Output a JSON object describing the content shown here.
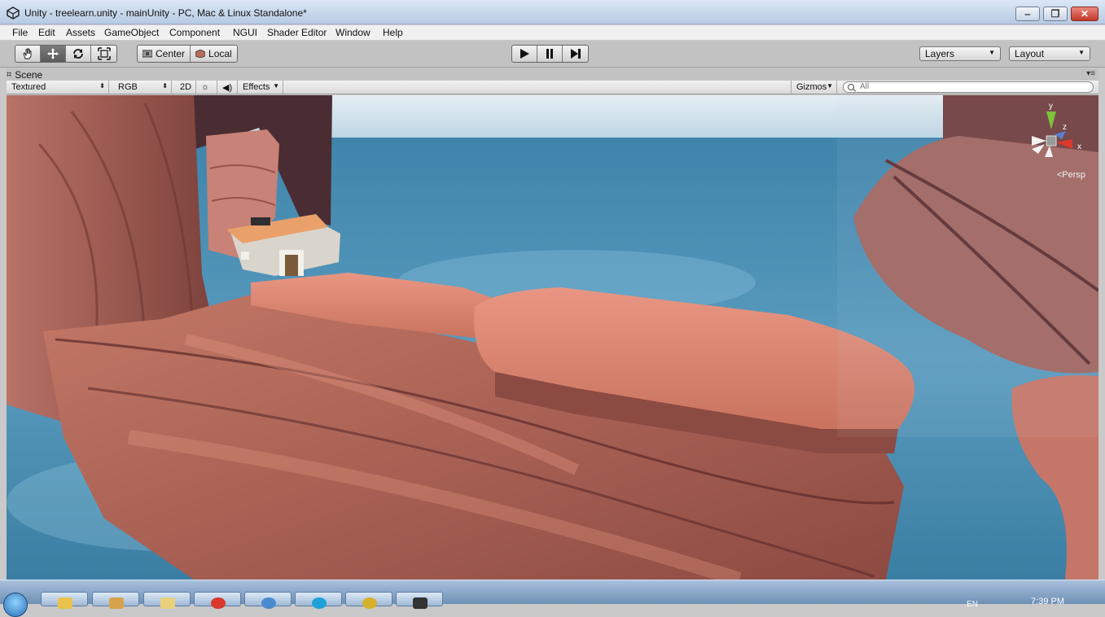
{
  "window": {
    "title": "Unity - treelearn.unity - mainUnity - PC, Mac & Linux Standalone*",
    "app_icon": "unity-logo-icon",
    "controls": [
      "minimize-icon",
      "maximize-icon",
      "close-icon"
    ]
  },
  "menu": {
    "items": [
      "File",
      "Edit",
      "Assets",
      "GameObject",
      "Component",
      "NGUI",
      "Shader Editor",
      "Window",
      "Help"
    ]
  },
  "toolbar": {
    "transform_tools": [
      "hand-icon",
      "move-icon",
      "rotate-icon",
      "scale-icon"
    ],
    "active_tool": "move-icon",
    "pivot_label": "Center",
    "space_label": "Local",
    "playback": [
      "play-icon",
      "pause-icon",
      "step-icon"
    ],
    "layers_label": "Layers",
    "layout_label": "Layout"
  },
  "scene": {
    "tab_label": "Scene",
    "tab_icon": "scene-grid-icon",
    "shading_mode": "Textured",
    "render_mode": "RGB",
    "mode_2d": "2D",
    "lighting_icon": "sun-icon",
    "audio_icon": "speaker-icon",
    "effects_label": "Effects",
    "gizmos_label": "Gizmos",
    "search_placeholder": "All",
    "gizmo_axes": {
      "y": "y",
      "z": "z",
      "x": "x"
    },
    "projection_label": "Persp"
  },
  "taskbar": {
    "items": [
      "windows-start-orb",
      "folder-icon",
      "explorer-icon",
      "chrome-icon",
      "ie-icon",
      "skype-icon",
      "avatar-icon",
      "unity-icon"
    ],
    "lang": "EN",
    "time": "7:39 PM"
  },
  "colors": {
    "sky": "#cfe3ee",
    "water": "#4f8fb0",
    "rock": "#b86b5c",
    "rock_dark": "#7a3f3a",
    "gizmo_y": "#7ec43a",
    "gizmo_x": "#d9392b"
  }
}
